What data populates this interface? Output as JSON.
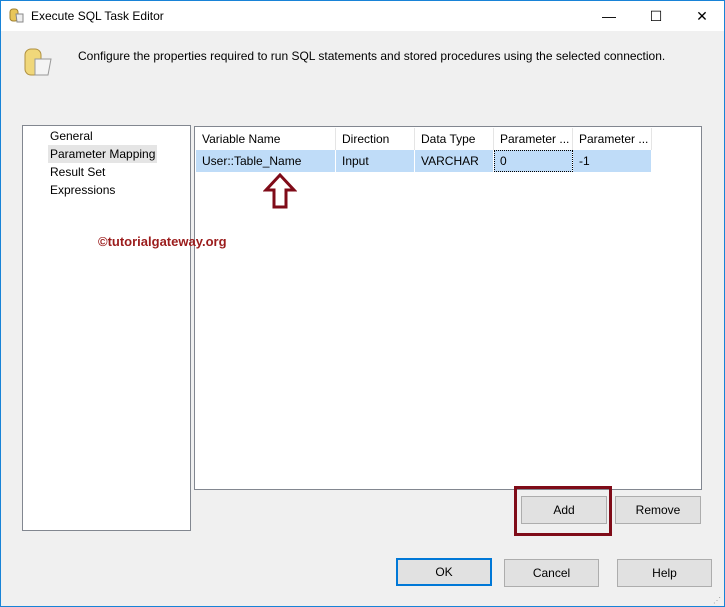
{
  "window": {
    "title": "Execute SQL Task Editor",
    "minimize": "—",
    "maximize": "☐",
    "close": "✕"
  },
  "description": "Configure the properties required to run SQL statements and stored procedures using the selected connection.",
  "nav": [
    {
      "label": "General"
    },
    {
      "label": "Parameter Mapping"
    },
    {
      "label": "Result Set"
    },
    {
      "label": "Expressions"
    }
  ],
  "grid": {
    "headers": [
      "Variable Name",
      "Direction",
      "Data Type",
      "Parameter ...",
      "Parameter ..."
    ],
    "rows": [
      [
        "User::Table_Name",
        "Input",
        "VARCHAR",
        "0",
        "-1"
      ]
    ]
  },
  "watermark": "©tutorialgateway.org",
  "buttons": {
    "add": "Add",
    "remove": "Remove",
    "ok": "OK",
    "cancel": "Cancel",
    "help": "Help"
  },
  "colors": {
    "highlight": "#7f0b18",
    "selection": "#bfdcf8",
    "accent": "#0078d7"
  }
}
